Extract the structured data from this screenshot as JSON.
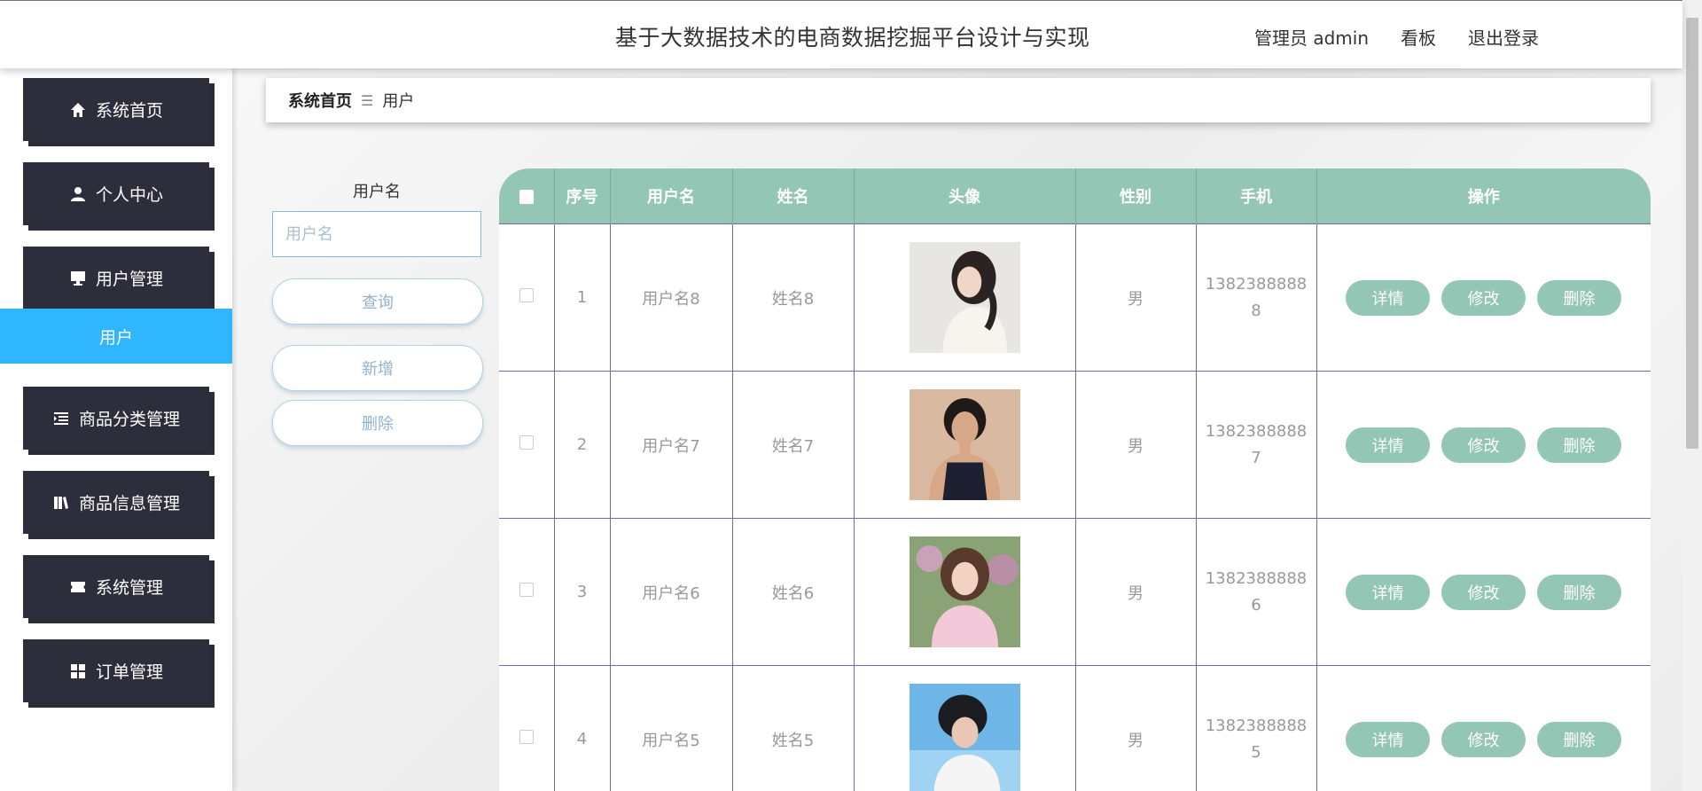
{
  "header": {
    "title": "基于大数据技术的电商数据挖掘平台设计与实现",
    "links": [
      "管理员 admin",
      "看板",
      "退出登录"
    ]
  },
  "sidebar": {
    "items": [
      {
        "label": "系统首页",
        "icon": "home-icon"
      },
      {
        "label": "个人中心",
        "icon": "user-icon"
      },
      {
        "label": "用户管理",
        "icon": "monitor-icon"
      },
      {
        "label": "商品分类管理",
        "icon": "list-indent-icon"
      },
      {
        "label": "商品信息管理",
        "icon": "book-icon"
      },
      {
        "label": "系统管理",
        "icon": "ticket-icon"
      },
      {
        "label": "订单管理",
        "icon": "grid-icon"
      }
    ],
    "submenu": {
      "label": "用户",
      "active": true
    }
  },
  "breadcrumb": {
    "home": "系统首页",
    "separator": "☰",
    "current": "用户"
  },
  "search": {
    "label": "用户名",
    "placeholder": "用户名",
    "query_label": "查询",
    "add_label": "新增",
    "delete_label": "删除"
  },
  "table": {
    "columns": [
      "",
      "序号",
      "用户名",
      "姓名",
      "头像",
      "性别",
      "手机",
      "操作"
    ],
    "rows": [
      {
        "index": "1",
        "username": "用户名8",
        "name": "姓名8",
        "gender": "男",
        "phone_line1": "1382388888",
        "phone_line2": "8"
      },
      {
        "index": "2",
        "username": "用户名7",
        "name": "姓名7",
        "gender": "男",
        "phone_line1": "1382388888",
        "phone_line2": "7"
      },
      {
        "index": "3",
        "username": "用户名6",
        "name": "姓名6",
        "gender": "男",
        "phone_line1": "1382388888",
        "phone_line2": "6"
      },
      {
        "index": "4",
        "username": "用户名5",
        "name": "姓名5",
        "gender": "男",
        "phone_line1": "1382388888",
        "phone_line2": "5"
      }
    ],
    "actions": [
      "详情",
      "修改",
      "删除"
    ]
  },
  "colors": {
    "accent_green": "#93c6b4",
    "sidebar_dark": "#2c2f3b",
    "active_blue": "#30b6ff"
  }
}
